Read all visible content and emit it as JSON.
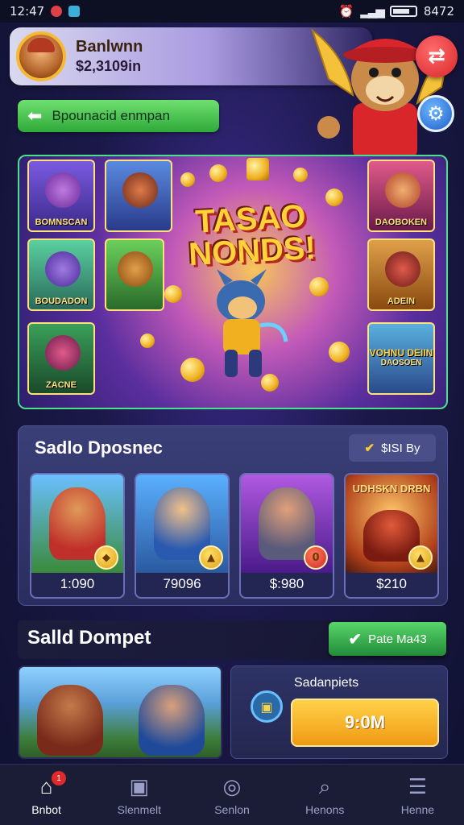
{
  "status_bar": {
    "time": "12:47",
    "right_text": "8472",
    "icons": [
      "notification-red-icon",
      "app-blue-icon",
      "alarm-icon",
      "signal-icon",
      "battery-icon"
    ]
  },
  "header": {
    "username": "Banlwnn",
    "balance": "$2,3109in",
    "avatar_icon": "player-avatar-icon"
  },
  "mascot": {
    "icon": "mascot-character-icon"
  },
  "actions": {
    "swap_icon": "⇄",
    "settings_icon": "⚙"
  },
  "promo_pill": {
    "label": "Bpounacid enmpan",
    "arrow": "⬅"
  },
  "hero": {
    "title_line1": "TASAO",
    "title_line2": "NONDS!",
    "tiles": [
      "BOMNSCAN",
      "BOUDADON",
      "ZACNE",
      "DAOBOKEN",
      "ADEIN",
      "VOHNU DEIIN",
      "DAOSOEN"
    ]
  },
  "featured": {
    "title": "Sadlo Dposnec",
    "badge_label": "$ISI By",
    "cards": [
      {
        "price": "1:090"
      },
      {
        "price": "79096"
      },
      {
        "price": "$:980"
      },
      {
        "price": "$210"
      }
    ],
    "card4_art_text": "UDHSKN DRBN"
  },
  "section2": {
    "title": "Salld Dompet",
    "button_label": "Pate Ma43",
    "claim_label": "Sadanpiets",
    "claim_button": "9:0M"
  },
  "nav": [
    {
      "label": "Bnbot",
      "icon": "home-icon",
      "badge": "1"
    },
    {
      "label": "Slenmelt",
      "icon": "card-icon"
    },
    {
      "label": "Senlon",
      "icon": "compass-icon"
    },
    {
      "label": "Henons",
      "icon": "search-icon"
    },
    {
      "label": "Henne",
      "icon": "menu-icon"
    }
  ],
  "colors": {
    "accent_green": "#3fbf4a",
    "accent_gold": "#f6b931",
    "accent_red": "#d8262a",
    "background": "#1b1848"
  }
}
